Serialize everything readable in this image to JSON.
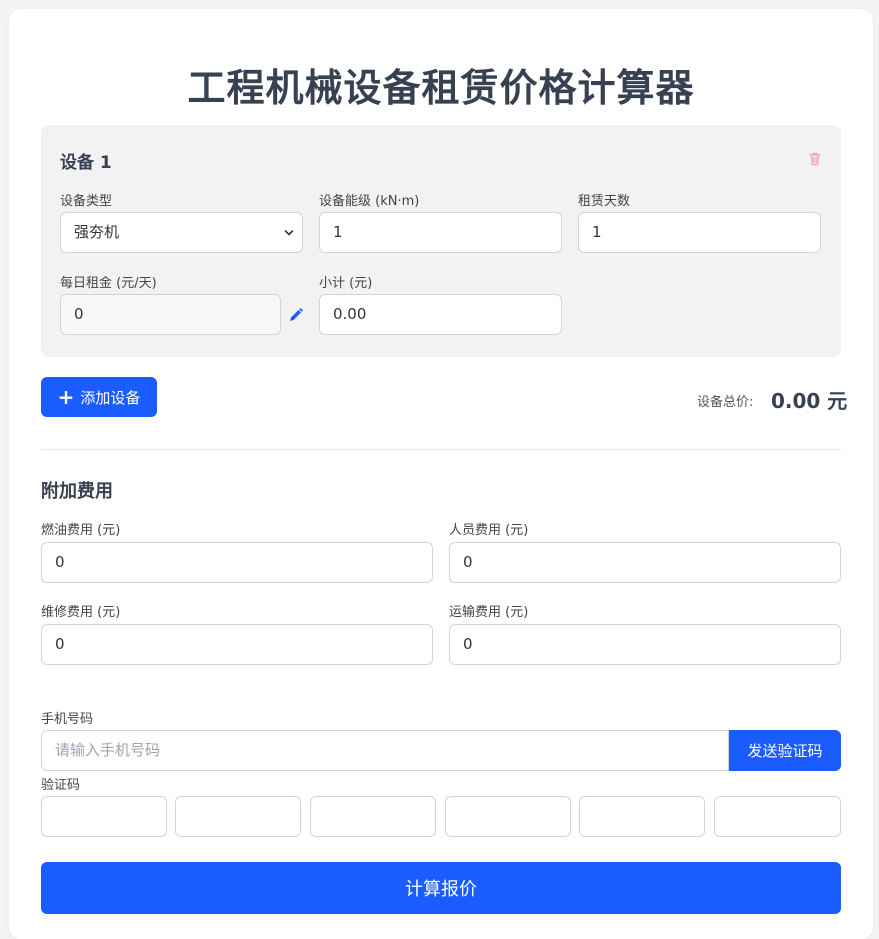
{
  "page": {
    "title": "工程机械设备租赁价格计算器"
  },
  "device": {
    "title": "设备 1",
    "type_label": "设备类型",
    "type_value": "强夯机",
    "energy_label": "设备能级 (kN·m)",
    "energy_value": "1",
    "days_label": "租赁天数",
    "days_value": "1",
    "daily_label": "每日租金 (元/天)",
    "daily_value": "0",
    "subtotal_label": "小计 (元)",
    "subtotal_value": "0.00"
  },
  "actions": {
    "add_device_label": "添加设备",
    "total_label": "设备总价:",
    "total_value": "0.00 元"
  },
  "extra": {
    "title": "附加费用",
    "fuel_label": "燃油费用 (元)",
    "fuel_value": "0",
    "staff_label": "人员费用 (元)",
    "staff_value": "0",
    "repair_label": "维修费用 (元)",
    "repair_value": "0",
    "transport_label": "运输费用 (元)",
    "transport_value": "0"
  },
  "verify": {
    "phone_label": "手机号码",
    "phone_placeholder": "请输入手机号码",
    "send_code_label": "发送验证码",
    "code_label": "验证码"
  },
  "submit": {
    "label": "计算报价"
  },
  "colors": {
    "accent": "#1a5cff",
    "danger_icon": "#f3a3a3",
    "pen_icon": "#1a5cff"
  },
  "icons": {
    "delete": "trash-icon",
    "edit": "pencil-icon",
    "add": "plus-icon",
    "dropdown": "chevron-down-icon"
  }
}
